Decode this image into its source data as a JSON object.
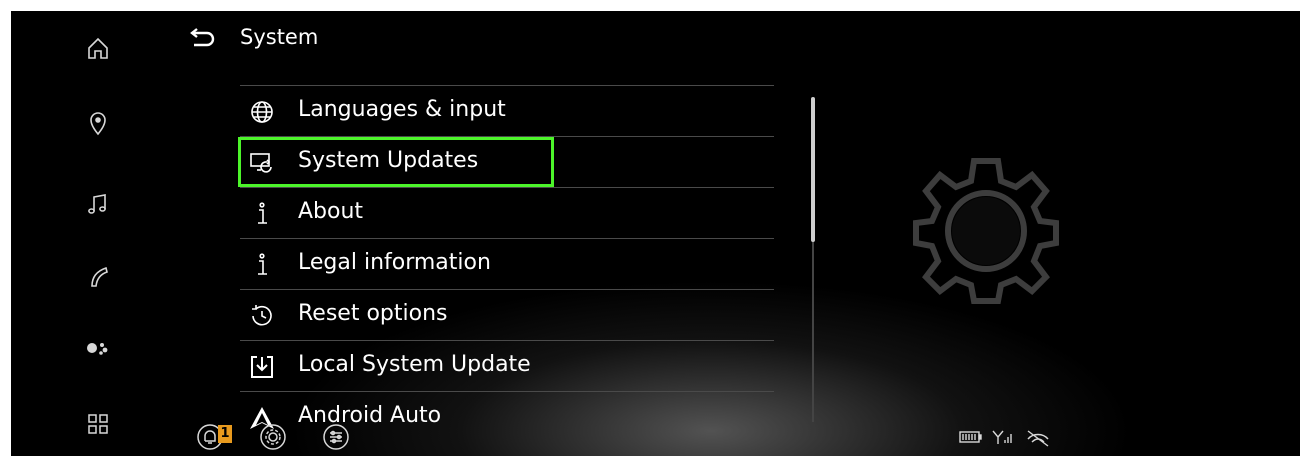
{
  "header": {
    "title": "System"
  },
  "menu": {
    "items": [
      {
        "label": "Languages & input",
        "icon": "globe-icon"
      },
      {
        "label": "System Updates",
        "icon": "screen-refresh-icon"
      },
      {
        "label": "About",
        "icon": "info-icon"
      },
      {
        "label": "Legal information",
        "icon": "info-icon"
      },
      {
        "label": "Reset options",
        "icon": "history-icon"
      },
      {
        "label": "Local System Update",
        "icon": "download-box-icon"
      },
      {
        "label": "Android Auto",
        "icon": "android-auto-icon"
      }
    ],
    "highlighted": "System Updates",
    "highlight_color": "#4cf52a"
  },
  "sidebar": {
    "items": [
      "home-icon",
      "location-pin-icon",
      "music-note-icon",
      "phone-icon",
      "assistant-icon",
      "apps-grid-icon"
    ]
  },
  "bottom_bar": {
    "notification_count": "1",
    "badge_color": "#e89a1e",
    "icons": [
      "bell-icon",
      "settings-icon",
      "sliders-icon"
    ],
    "status_icons": [
      "battery-icon",
      "signal-icon",
      "no-connection-icon"
    ]
  }
}
